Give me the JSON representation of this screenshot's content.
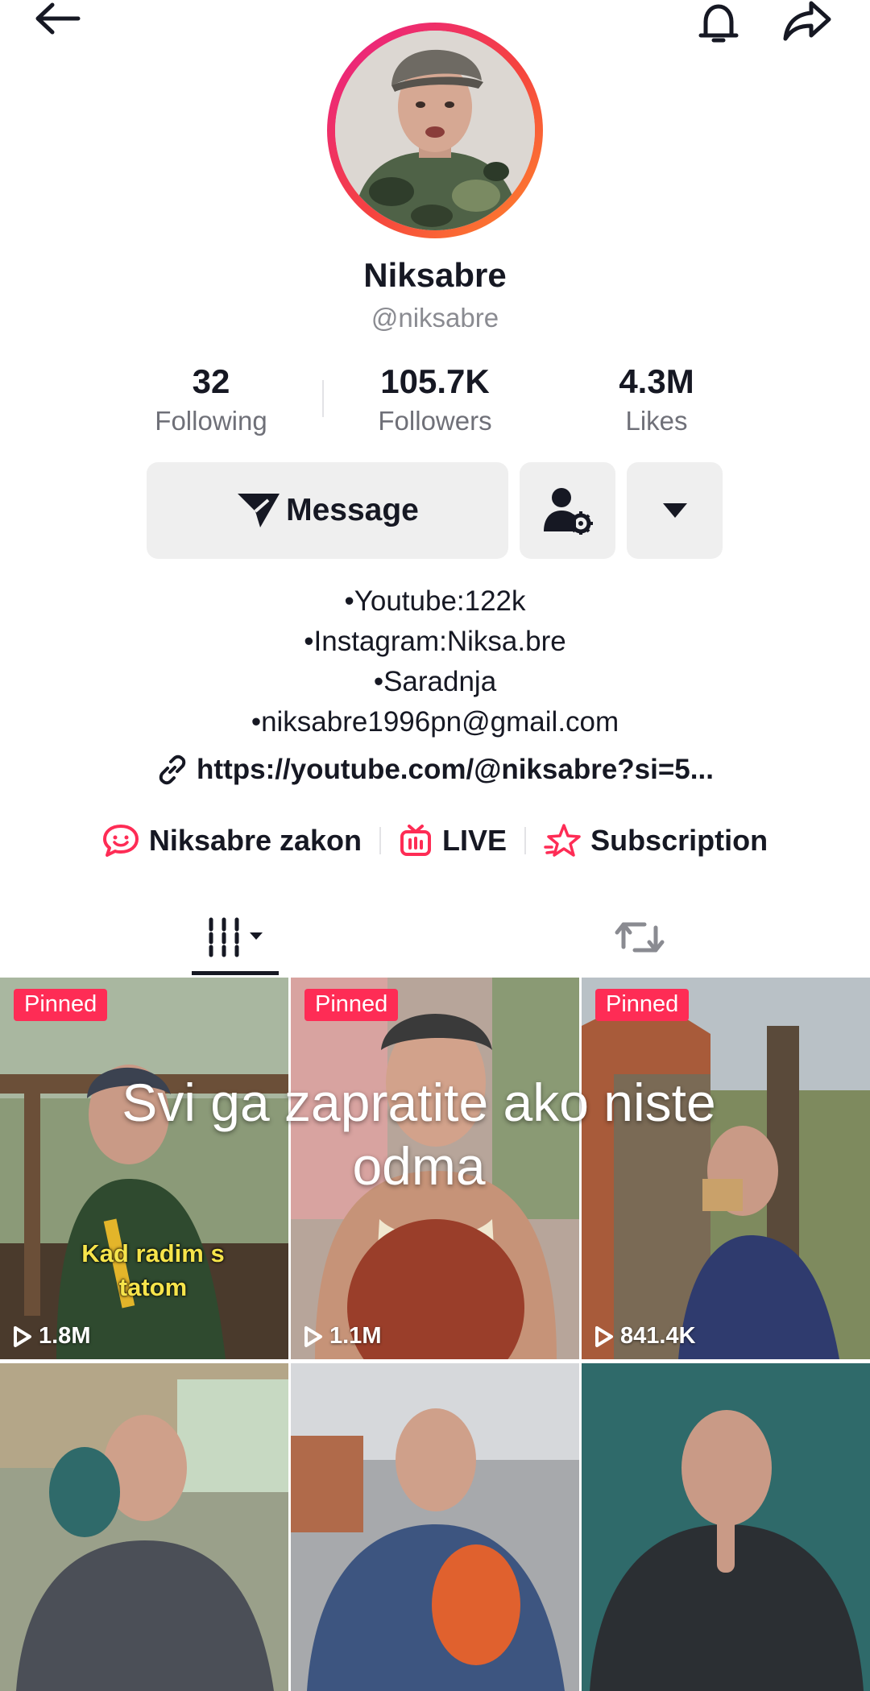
{
  "profile": {
    "display_name": "Niksabre",
    "username": "@niksabre"
  },
  "stats": [
    {
      "value": "32",
      "label": "Following"
    },
    {
      "value": "105.7K",
      "label": "Followers"
    },
    {
      "value": "4.3M",
      "label": "Likes"
    }
  ],
  "actions": {
    "message_label": "Message"
  },
  "bio": {
    "lines": [
      "•Youtube:122k",
      "•Instagram:Niksa.bre",
      "•Saradnja",
      "•niksabre1996pn@gmail.com"
    ],
    "link": "https://youtube.com/@niksabre?si=5..."
  },
  "chips": [
    {
      "label": "Niksabre zakon",
      "icon": "group-chat-icon"
    },
    {
      "label": "LIVE",
      "icon": "live-tv-icon"
    },
    {
      "label": "Subscription",
      "icon": "subscription-star-icon"
    }
  ],
  "overlay": {
    "line1": "Svi ga zapratite ako niste",
    "line2": "odma"
  },
  "videos": [
    {
      "pinned": "Pinned",
      "views": "1.8M",
      "caption_line1": "Kad radim s",
      "caption_line2": "tatom"
    },
    {
      "pinned": "Pinned",
      "views": "1.1M"
    },
    {
      "pinned": "Pinned",
      "views": "841.4K"
    },
    {},
    {},
    {}
  ],
  "colors": {
    "accent": "#fe2c55",
    "text": "#161823",
    "muted": "#8a8b91",
    "button_bg": "#efefef"
  }
}
